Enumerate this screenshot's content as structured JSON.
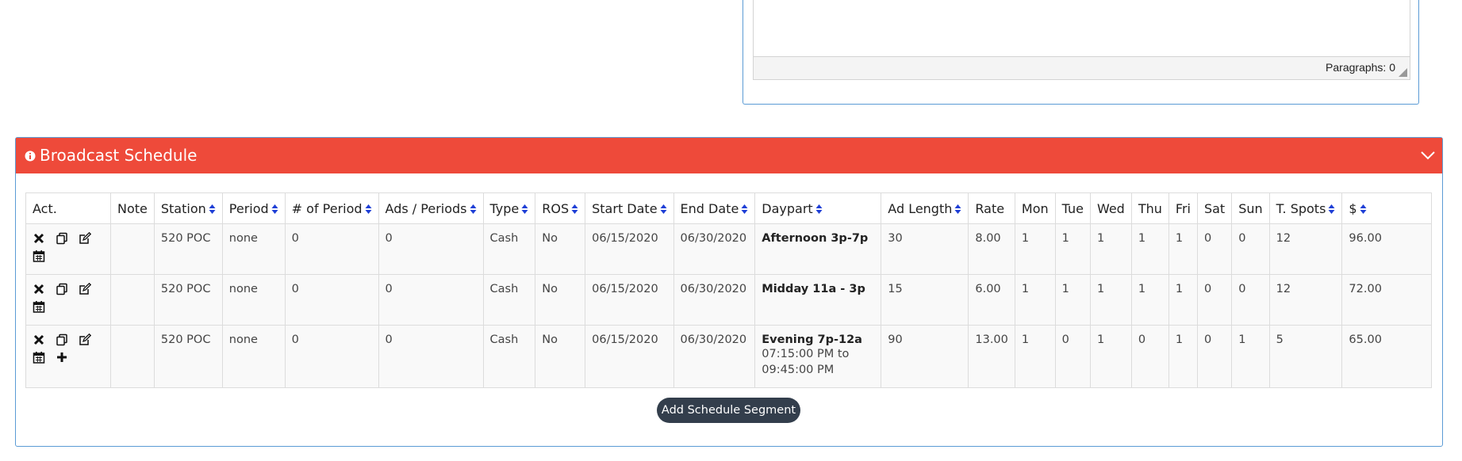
{
  "editor": {
    "paragraphs_label": "Paragraphs: 0"
  },
  "card": {
    "title": "Broadcast Schedule"
  },
  "table": {
    "headers": [
      "Act.",
      "Note",
      "Station",
      "Period",
      "# of Period",
      "Ads / Periods",
      "Type",
      "ROS",
      "Start Date",
      "End Date",
      "Daypart",
      "Ad Length",
      "Rate",
      "Mon",
      "Tue",
      "Wed",
      "Thu",
      "Fri",
      "Sat",
      "Sun",
      "T. Spots",
      "$"
    ],
    "rows": [
      {
        "note": "",
        "station": "520 POC",
        "period": "none",
        "num_period": "0",
        "ads_periods": "0",
        "type": "Cash",
        "ros": "No",
        "start": "06/15/2020",
        "end": "06/30/2020",
        "daypart": "Afternoon 3p-7p",
        "time1": "",
        "time2": "",
        "ad_length": "30",
        "rate": "8.00",
        "mon": "1",
        "tue": "1",
        "wed": "1",
        "thu": "1",
        "fri": "1",
        "sat": "0",
        "sun": "0",
        "spots": "12",
        "amount": "96.00"
      },
      {
        "note": "",
        "station": "520 POC",
        "period": "none",
        "num_period": "0",
        "ads_periods": "0",
        "type": "Cash",
        "ros": "No",
        "start": "06/15/2020",
        "end": "06/30/2020",
        "daypart": "Midday 11a - 3p",
        "time1": "",
        "time2": "",
        "ad_length": "15",
        "rate": "6.00",
        "mon": "1",
        "tue": "1",
        "wed": "1",
        "thu": "1",
        "fri": "1",
        "sat": "0",
        "sun": "0",
        "spots": "12",
        "amount": "72.00"
      },
      {
        "note": "",
        "station": "520 POC",
        "period": "none",
        "num_period": "0",
        "ads_periods": "0",
        "type": "Cash",
        "ros": "No",
        "start": "06/15/2020",
        "end": "06/30/2020",
        "daypart": "Evening 7p-12a",
        "time1": "07:15:00 PM to",
        "time2": "09:45:00 PM",
        "ad_length": "90",
        "rate": "13.00",
        "mon": "1",
        "tue": "0",
        "wed": "1",
        "thu": "0",
        "fri": "1",
        "sat": "0",
        "sun": "1",
        "spots": "5",
        "amount": "65.00"
      }
    ]
  },
  "add_button_label": "Add Schedule Segment",
  "colors": {
    "header_bg": "#ee4a3a",
    "button_bg": "#333e4c",
    "sort_icon": "#1f3fd6",
    "panel_border": "#5b9bd5"
  }
}
